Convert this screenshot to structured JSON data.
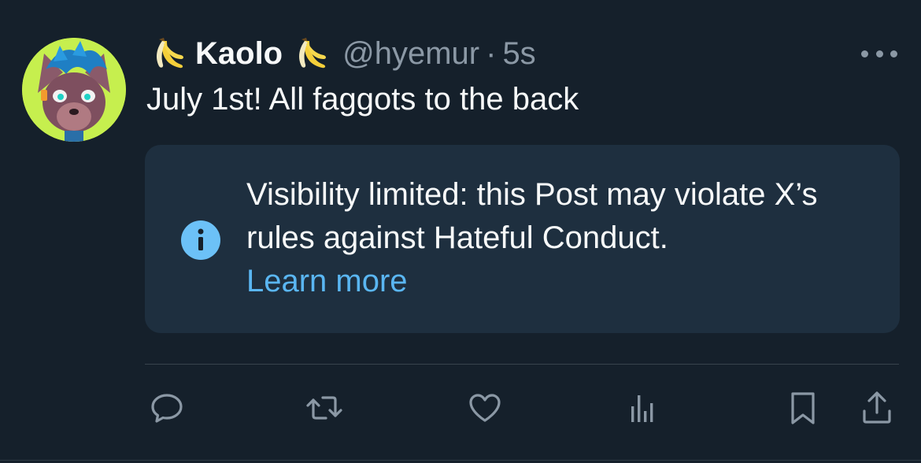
{
  "post": {
    "author": {
      "display_name": "Kaolo",
      "handle": "@hyemur",
      "separator": "·",
      "time": "5s",
      "name_emoji_icon": "banana-icon"
    },
    "text": "July 1st! All faggots to the back",
    "notice": {
      "icon": "info-icon",
      "message": "Visibility limited: this Post may violate X’s rules against Hateful Conduct.",
      "link_text": "Learn more"
    },
    "actions": [
      {
        "name": "reply",
        "icon": "comment-icon"
      },
      {
        "name": "repost",
        "icon": "repost-icon"
      },
      {
        "name": "like",
        "icon": "heart-icon"
      },
      {
        "name": "views",
        "icon": "analytics-icon"
      },
      {
        "name": "bookmark",
        "icon": "bookmark-icon"
      },
      {
        "name": "share",
        "icon": "share-icon"
      }
    ]
  },
  "colors": {
    "background": "#15202b",
    "notice_background": "#1e2f3f",
    "text_primary": "#f7f9f9",
    "text_secondary": "#8b98a5",
    "link": "#5ab6f2",
    "info_icon": "#6cc1f7",
    "avatar_background": "#c6ef4e"
  }
}
